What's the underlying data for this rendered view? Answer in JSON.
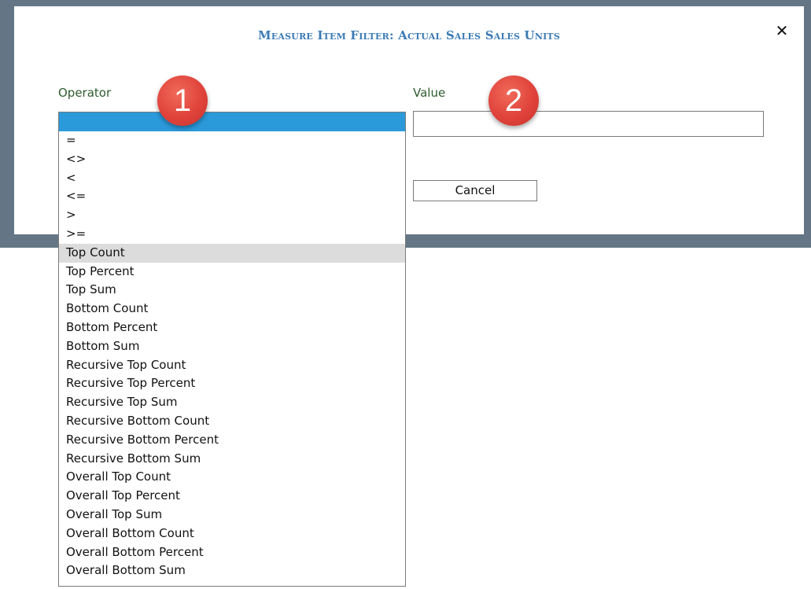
{
  "dialog": {
    "title": "Measure Item Filter: Actual Sales Sales Units",
    "close_glyph": "✕",
    "operator_label": "Operator",
    "value_label": "Value",
    "value_input": "",
    "cancel_label": "Cancel"
  },
  "badges": {
    "one": "1",
    "two": "2"
  },
  "operator_options": [
    "",
    "=",
    "<>",
    "<",
    "<=",
    ">",
    ">=",
    "Top Count",
    "Top Percent",
    "Top Sum",
    "Bottom Count",
    "Bottom Percent",
    "Bottom Sum",
    "Recursive Top Count",
    "Recursive Top Percent",
    "Recursive Top Sum",
    "Recursive Bottom Count",
    "Recursive Bottom Percent",
    "Recursive Bottom Sum",
    "Overall Top Count",
    "Overall Top Percent",
    "Overall Top Sum",
    "Overall Bottom Count",
    "Overall Bottom Percent",
    "Overall Bottom Sum"
  ],
  "selected_option_index": 0,
  "hovered_option_index": 7,
  "colors": {
    "frame": "#647686",
    "title": "#3b7ab4",
    "label": "#2f5b2f",
    "selected": "#2b9ada",
    "hover": "#dcdcdc",
    "badge": "#e0433b"
  },
  "icons": {
    "close": "close-icon"
  }
}
